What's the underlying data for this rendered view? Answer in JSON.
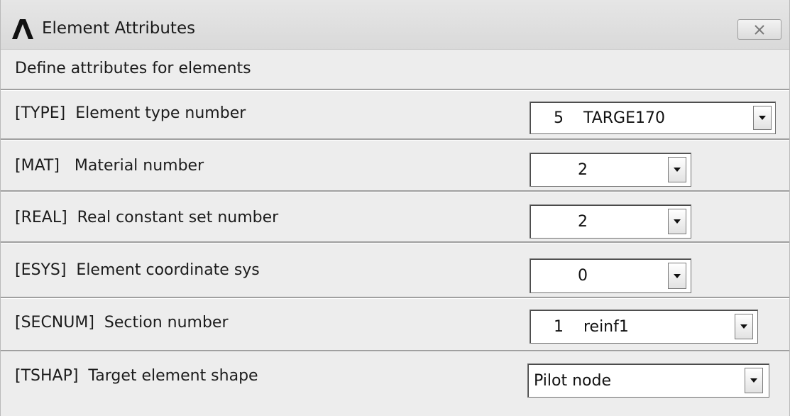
{
  "window": {
    "title": "Element Attributes",
    "close_glyph": "✕",
    "description": "Define attributes for elements"
  },
  "fields": [
    {
      "label": "[TYPE]  Element type number",
      "value": "5    TARGE170"
    },
    {
      "label": "[MAT]   Material number",
      "value": "2"
    },
    {
      "label": "[REAL]  Real constant set number",
      "value": "2"
    },
    {
      "label": "[ESYS]  Element coordinate sys",
      "value": "0"
    },
    {
      "label": "[SECNUM]  Section number",
      "value": "1    reinf1"
    },
    {
      "label": "[TSHAP]  Target element shape",
      "value": "Pilot node"
    }
  ],
  "icons": {
    "logo": "ansys-logo-icon",
    "close": "close-icon",
    "dropdown": "dropdown-arrow-icon"
  },
  "colors": {
    "window_bg": "#ededed",
    "titlebar_bg": "#dcdcdc",
    "combo_bg": "#ffffff",
    "divider": "#a0a0a0"
  }
}
